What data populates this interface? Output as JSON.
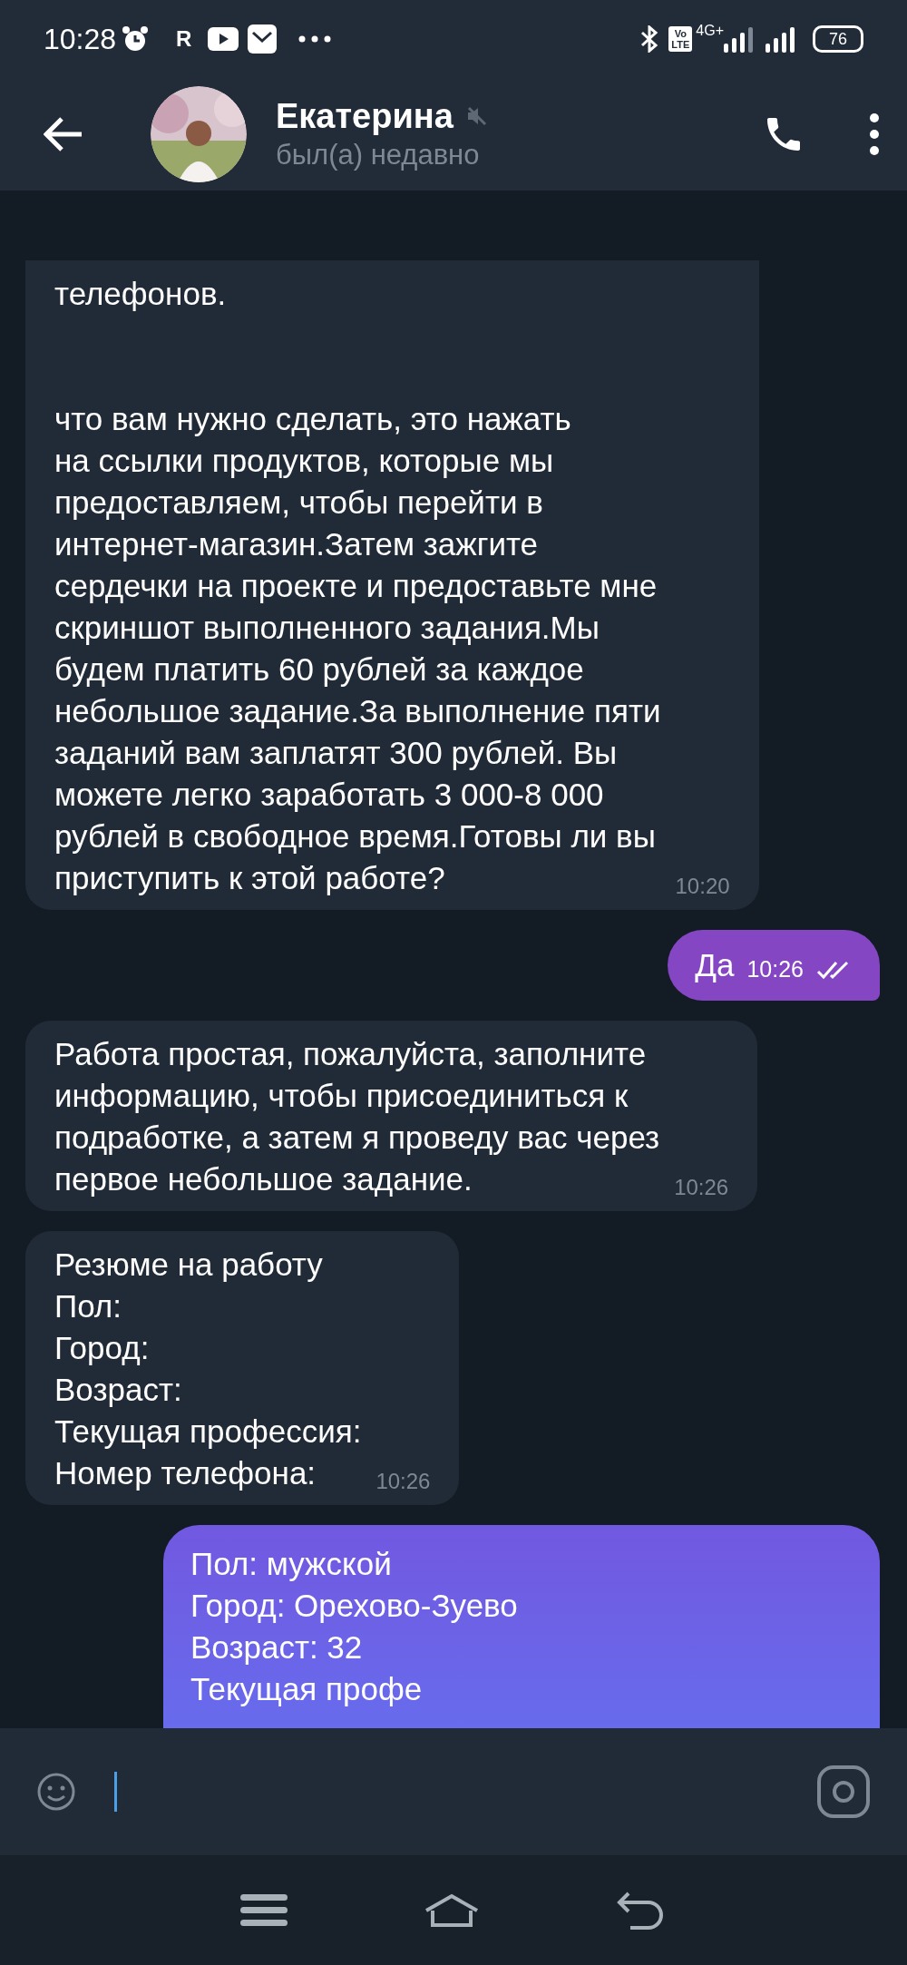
{
  "status_bar": {
    "time": "10:28",
    "notification_letter": "R",
    "volte_top": "Vo",
    "volte_bottom": "LTE",
    "network": "4G+",
    "battery": "76"
  },
  "header": {
    "name": "Екатерина",
    "muted": true,
    "status": "был(а) недавно"
  },
  "messages": [
    {
      "kind": "in",
      "text": "телефонов.\n\n\nчто вам нужно сделать, это нажать\nна ссылки продуктов, которые мы\nпредоставляем, чтобы перейти в\nинтернет-магазин.Затем зажгите\nсердечки на проекте и предоставьте мне\nскриншот выполненного задания.Мы\nбудем платить 60 рублей за каждое\nнебольшое задание.За выполнение пяти\nзаданий вам заплатят 300 рублей. Вы\nможете легко заработать 3 000-8 000\nрублей в свободное время.Готовы ли вы\nприступить к этой работе?",
      "time": "10:20"
    },
    {
      "kind": "out",
      "text": "Да",
      "time": "10:26",
      "read": true
    },
    {
      "kind": "in",
      "text": "Работа простая, пожалуйста, заполните\nинформацию, чтобы присоединиться к\nподработке, а затем я проведу вас через\nпервое небольшое задание.",
      "time": "10:26"
    },
    {
      "kind": "in",
      "text": "Резюме на работу\nПол:\nГород:\nВозраст:\nТекущая профессия:\nНомер телефона:",
      "time": "10:26"
    },
    {
      "kind": "out_cut",
      "text": "Пол: мужской\nГород: Орехово-Зуево\nВозраст: 32\nТекущая профе"
    }
  ]
}
